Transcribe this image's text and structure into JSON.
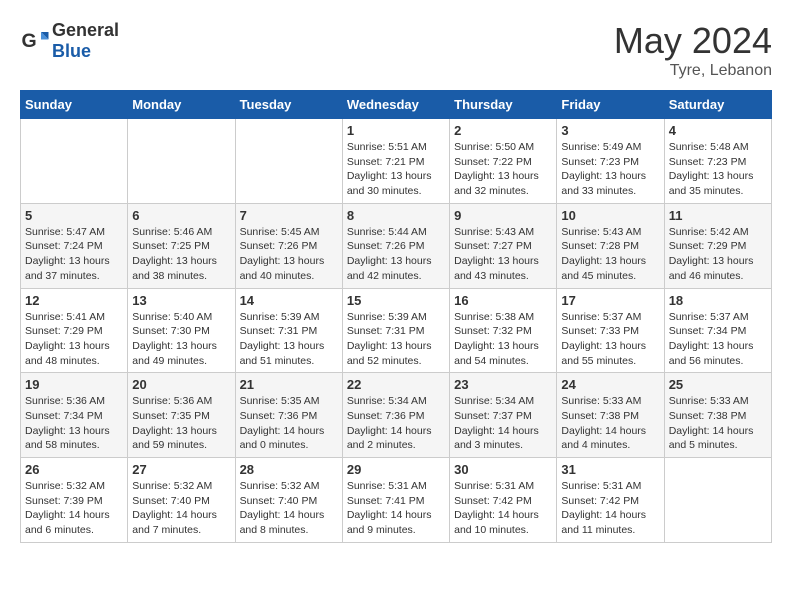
{
  "header": {
    "logo": {
      "general": "General",
      "blue": "Blue"
    },
    "title": "May 2024",
    "location": "Tyre, Lebanon"
  },
  "weekdays": [
    "Sunday",
    "Monday",
    "Tuesday",
    "Wednesday",
    "Thursday",
    "Friday",
    "Saturday"
  ],
  "weeks": [
    [
      {
        "day": null
      },
      {
        "day": null
      },
      {
        "day": null
      },
      {
        "day": 1,
        "sunrise": "Sunrise: 5:51 AM",
        "sunset": "Sunset: 7:21 PM",
        "daylight": "Daylight: 13 hours and 30 minutes."
      },
      {
        "day": 2,
        "sunrise": "Sunrise: 5:50 AM",
        "sunset": "Sunset: 7:22 PM",
        "daylight": "Daylight: 13 hours and 32 minutes."
      },
      {
        "day": 3,
        "sunrise": "Sunrise: 5:49 AM",
        "sunset": "Sunset: 7:23 PM",
        "daylight": "Daylight: 13 hours and 33 minutes."
      },
      {
        "day": 4,
        "sunrise": "Sunrise: 5:48 AM",
        "sunset": "Sunset: 7:23 PM",
        "daylight": "Daylight: 13 hours and 35 minutes."
      }
    ],
    [
      {
        "day": 5,
        "sunrise": "Sunrise: 5:47 AM",
        "sunset": "Sunset: 7:24 PM",
        "daylight": "Daylight: 13 hours and 37 minutes."
      },
      {
        "day": 6,
        "sunrise": "Sunrise: 5:46 AM",
        "sunset": "Sunset: 7:25 PM",
        "daylight": "Daylight: 13 hours and 38 minutes."
      },
      {
        "day": 7,
        "sunrise": "Sunrise: 5:45 AM",
        "sunset": "Sunset: 7:26 PM",
        "daylight": "Daylight: 13 hours and 40 minutes."
      },
      {
        "day": 8,
        "sunrise": "Sunrise: 5:44 AM",
        "sunset": "Sunset: 7:26 PM",
        "daylight": "Daylight: 13 hours and 42 minutes."
      },
      {
        "day": 9,
        "sunrise": "Sunrise: 5:43 AM",
        "sunset": "Sunset: 7:27 PM",
        "daylight": "Daylight: 13 hours and 43 minutes."
      },
      {
        "day": 10,
        "sunrise": "Sunrise: 5:43 AM",
        "sunset": "Sunset: 7:28 PM",
        "daylight": "Daylight: 13 hours and 45 minutes."
      },
      {
        "day": 11,
        "sunrise": "Sunrise: 5:42 AM",
        "sunset": "Sunset: 7:29 PM",
        "daylight": "Daylight: 13 hours and 46 minutes."
      }
    ],
    [
      {
        "day": 12,
        "sunrise": "Sunrise: 5:41 AM",
        "sunset": "Sunset: 7:29 PM",
        "daylight": "Daylight: 13 hours and 48 minutes."
      },
      {
        "day": 13,
        "sunrise": "Sunrise: 5:40 AM",
        "sunset": "Sunset: 7:30 PM",
        "daylight": "Daylight: 13 hours and 49 minutes."
      },
      {
        "day": 14,
        "sunrise": "Sunrise: 5:39 AM",
        "sunset": "Sunset: 7:31 PM",
        "daylight": "Daylight: 13 hours and 51 minutes."
      },
      {
        "day": 15,
        "sunrise": "Sunrise: 5:39 AM",
        "sunset": "Sunset: 7:31 PM",
        "daylight": "Daylight: 13 hours and 52 minutes."
      },
      {
        "day": 16,
        "sunrise": "Sunrise: 5:38 AM",
        "sunset": "Sunset: 7:32 PM",
        "daylight": "Daylight: 13 hours and 54 minutes."
      },
      {
        "day": 17,
        "sunrise": "Sunrise: 5:37 AM",
        "sunset": "Sunset: 7:33 PM",
        "daylight": "Daylight: 13 hours and 55 minutes."
      },
      {
        "day": 18,
        "sunrise": "Sunrise: 5:37 AM",
        "sunset": "Sunset: 7:34 PM",
        "daylight": "Daylight: 13 hours and 56 minutes."
      }
    ],
    [
      {
        "day": 19,
        "sunrise": "Sunrise: 5:36 AM",
        "sunset": "Sunset: 7:34 PM",
        "daylight": "Daylight: 13 hours and 58 minutes."
      },
      {
        "day": 20,
        "sunrise": "Sunrise: 5:36 AM",
        "sunset": "Sunset: 7:35 PM",
        "daylight": "Daylight: 13 hours and 59 minutes."
      },
      {
        "day": 21,
        "sunrise": "Sunrise: 5:35 AM",
        "sunset": "Sunset: 7:36 PM",
        "daylight": "Daylight: 14 hours and 0 minutes."
      },
      {
        "day": 22,
        "sunrise": "Sunrise: 5:34 AM",
        "sunset": "Sunset: 7:36 PM",
        "daylight": "Daylight: 14 hours and 2 minutes."
      },
      {
        "day": 23,
        "sunrise": "Sunrise: 5:34 AM",
        "sunset": "Sunset: 7:37 PM",
        "daylight": "Daylight: 14 hours and 3 minutes."
      },
      {
        "day": 24,
        "sunrise": "Sunrise: 5:33 AM",
        "sunset": "Sunset: 7:38 PM",
        "daylight": "Daylight: 14 hours and 4 minutes."
      },
      {
        "day": 25,
        "sunrise": "Sunrise: 5:33 AM",
        "sunset": "Sunset: 7:38 PM",
        "daylight": "Daylight: 14 hours and 5 minutes."
      }
    ],
    [
      {
        "day": 26,
        "sunrise": "Sunrise: 5:32 AM",
        "sunset": "Sunset: 7:39 PM",
        "daylight": "Daylight: 14 hours and 6 minutes."
      },
      {
        "day": 27,
        "sunrise": "Sunrise: 5:32 AM",
        "sunset": "Sunset: 7:40 PM",
        "daylight": "Daylight: 14 hours and 7 minutes."
      },
      {
        "day": 28,
        "sunrise": "Sunrise: 5:32 AM",
        "sunset": "Sunset: 7:40 PM",
        "daylight": "Daylight: 14 hours and 8 minutes."
      },
      {
        "day": 29,
        "sunrise": "Sunrise: 5:31 AM",
        "sunset": "Sunset: 7:41 PM",
        "daylight": "Daylight: 14 hours and 9 minutes."
      },
      {
        "day": 30,
        "sunrise": "Sunrise: 5:31 AM",
        "sunset": "Sunset: 7:42 PM",
        "daylight": "Daylight: 14 hours and 10 minutes."
      },
      {
        "day": 31,
        "sunrise": "Sunrise: 5:31 AM",
        "sunset": "Sunset: 7:42 PM",
        "daylight": "Daylight: 14 hours and 11 minutes."
      },
      {
        "day": null
      }
    ]
  ]
}
